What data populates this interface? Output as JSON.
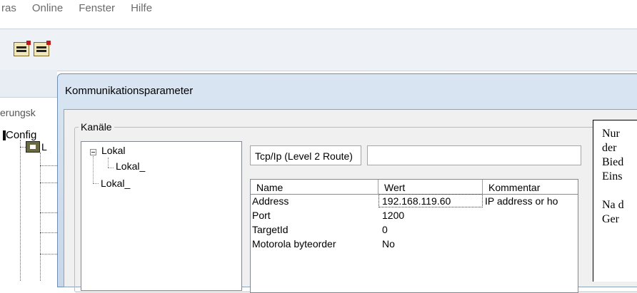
{
  "menubar": {
    "items": [
      "ras",
      "Online",
      "Fenster",
      "Hilfe"
    ]
  },
  "toolbar": {
    "buttons": [
      "build-icon",
      "rebuild-icon"
    ]
  },
  "left_panel": {
    "partial_label": "erungsk",
    "config_label": "Config",
    "plc_label": "L"
  },
  "dialog": {
    "title": "Kommunikationsparameter",
    "group_label": "Kanäle",
    "tree": [
      "Lokal",
      "Lokal_",
      "Lokal_"
    ],
    "protocol": "Tcp/Ip (Level 2 Route)",
    "protocol_extra": "",
    "grid": {
      "columns": [
        "Name",
        "Wert",
        "Kommentar"
      ],
      "rows": [
        [
          "Address",
          "192.168.119.60",
          "IP address or ho"
        ],
        [
          "Port",
          "1200",
          ""
        ],
        [
          "TargetId",
          "0",
          ""
        ],
        [
          "Motorola byteorder",
          "No",
          ""
        ]
      ]
    }
  },
  "note": {
    "lines": [
      "Nur",
      "der",
      "Bied",
      "Eins",
      "",
      "Na d",
      "Ger"
    ]
  }
}
